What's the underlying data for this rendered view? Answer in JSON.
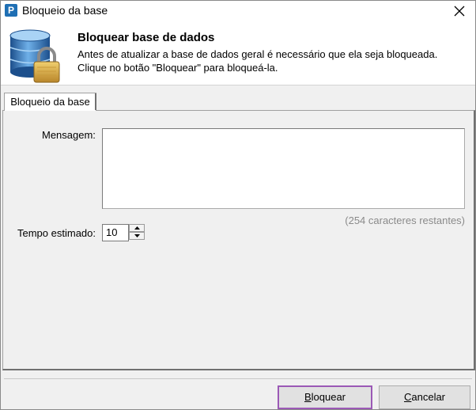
{
  "window": {
    "title": "Bloqueio da base",
    "app_icon": "P"
  },
  "header": {
    "title": "Bloquear base de dados",
    "description": "Antes de atualizar a base de dados geral é necessário que ela seja bloqueada. Clique no botão \"Bloquear\" para bloqueá-la."
  },
  "tabs": [
    {
      "label": "Bloqueio da base"
    }
  ],
  "form": {
    "message_label": "Mensagem:",
    "message_value": "",
    "remaining": "(254 caracteres restantes)",
    "time_label": "Tempo estimado:",
    "time_value": "10"
  },
  "buttons": {
    "lock_first": "B",
    "lock_rest": "loquear",
    "cancel_first": "C",
    "cancel_rest": "ancelar"
  },
  "colors": {
    "accent_focus": "#9b59b6",
    "db_blue": "#2b6fb5",
    "lock_gold": "#d8a63a"
  }
}
